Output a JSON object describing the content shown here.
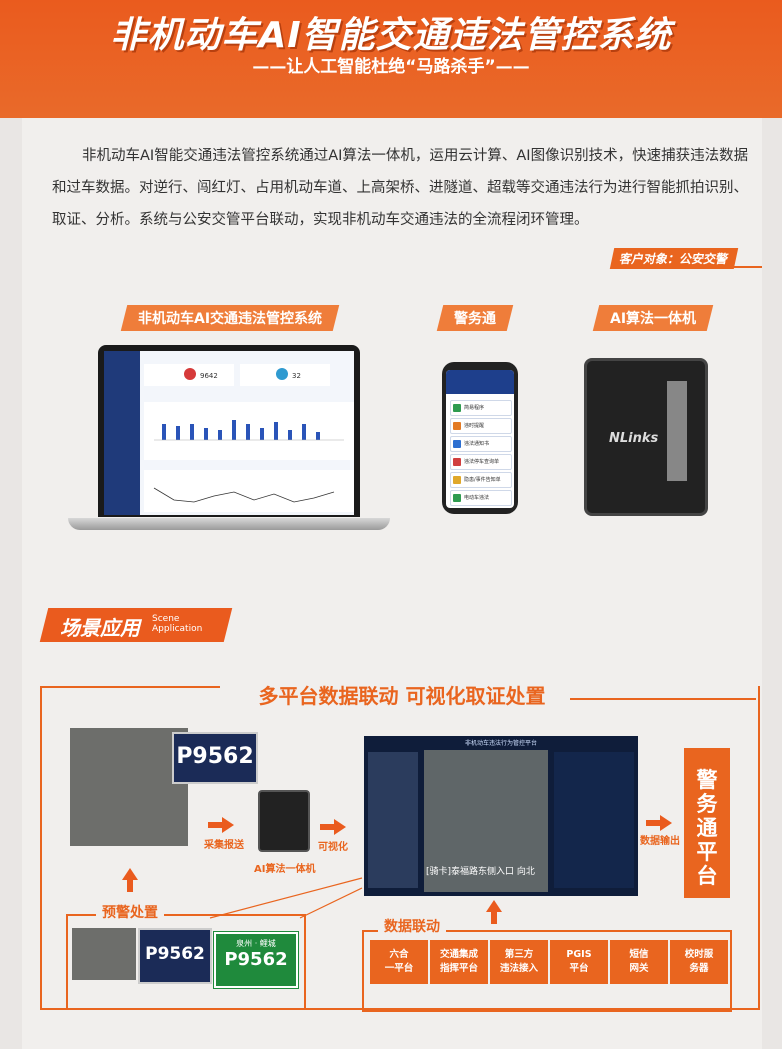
{
  "header": {
    "title": "非机动车AI智能交通违法管控系统",
    "subtitle": "——让人工智能杜绝“马路杀手”——"
  },
  "intro": "非机动车AI智能交通违法管控系统通过AI算法一体机，运用云计算、AI图像识别技术，快速捕获违法数据和过车数据。对逆行、闯红灯、占用机动车道、上高架桥、进隧道、超载等交通违法行为进行智能抓拍识别、取证、分析。系统与公安交管平台联动，实现非机动车交通违法的全流程闭环管理。",
  "customer": "客户对象：公安交警",
  "products": [
    {
      "label": "非机动车AI交通违法管控系统"
    },
    {
      "label": "警务通"
    },
    {
      "label": "AI算法一体机"
    }
  ],
  "laptop": {
    "stat1": "9642",
    "stat2": "32"
  },
  "phone": {
    "items": [
      "简易程序",
      "违时提醒",
      "违法通知书",
      "违法停车查询单",
      "隐患/事件告知单",
      "电动车违法"
    ],
    "colors": [
      "#2e9b4f",
      "#e37b25",
      "#2c6fd1",
      "#d13f3f",
      "#e0a82a",
      "#2e9b4f"
    ]
  },
  "server": {
    "brand": "NLinks"
  },
  "scene": {
    "cn": "场景应用",
    "en1": "Scene",
    "en2": "Application"
  },
  "diagram": {
    "title": "多平台数据联动  可视化取证处置",
    "plate": "P9562",
    "collect": "采集报送",
    "machine": "AI算法一体机",
    "visual": "可视化",
    "output": "数据输出",
    "jwt": [
      "警",
      "务",
      "通",
      "平",
      "台"
    ],
    "platform_title": "非机动车违法行为管控平台",
    "platform_caption": "[骑卡]泰福路东侧入口 向北",
    "warn": "预警处置",
    "green_top": "泉州 · 鲤城",
    "green_plate": "P9562",
    "link": "数据联动",
    "link_boxes": [
      "六合\n一平台",
      "交通集成\n指挥平台",
      "第三方\n违法接入",
      "PGIS\n平台",
      "短信\n网关",
      "校时服\n务器"
    ]
  }
}
